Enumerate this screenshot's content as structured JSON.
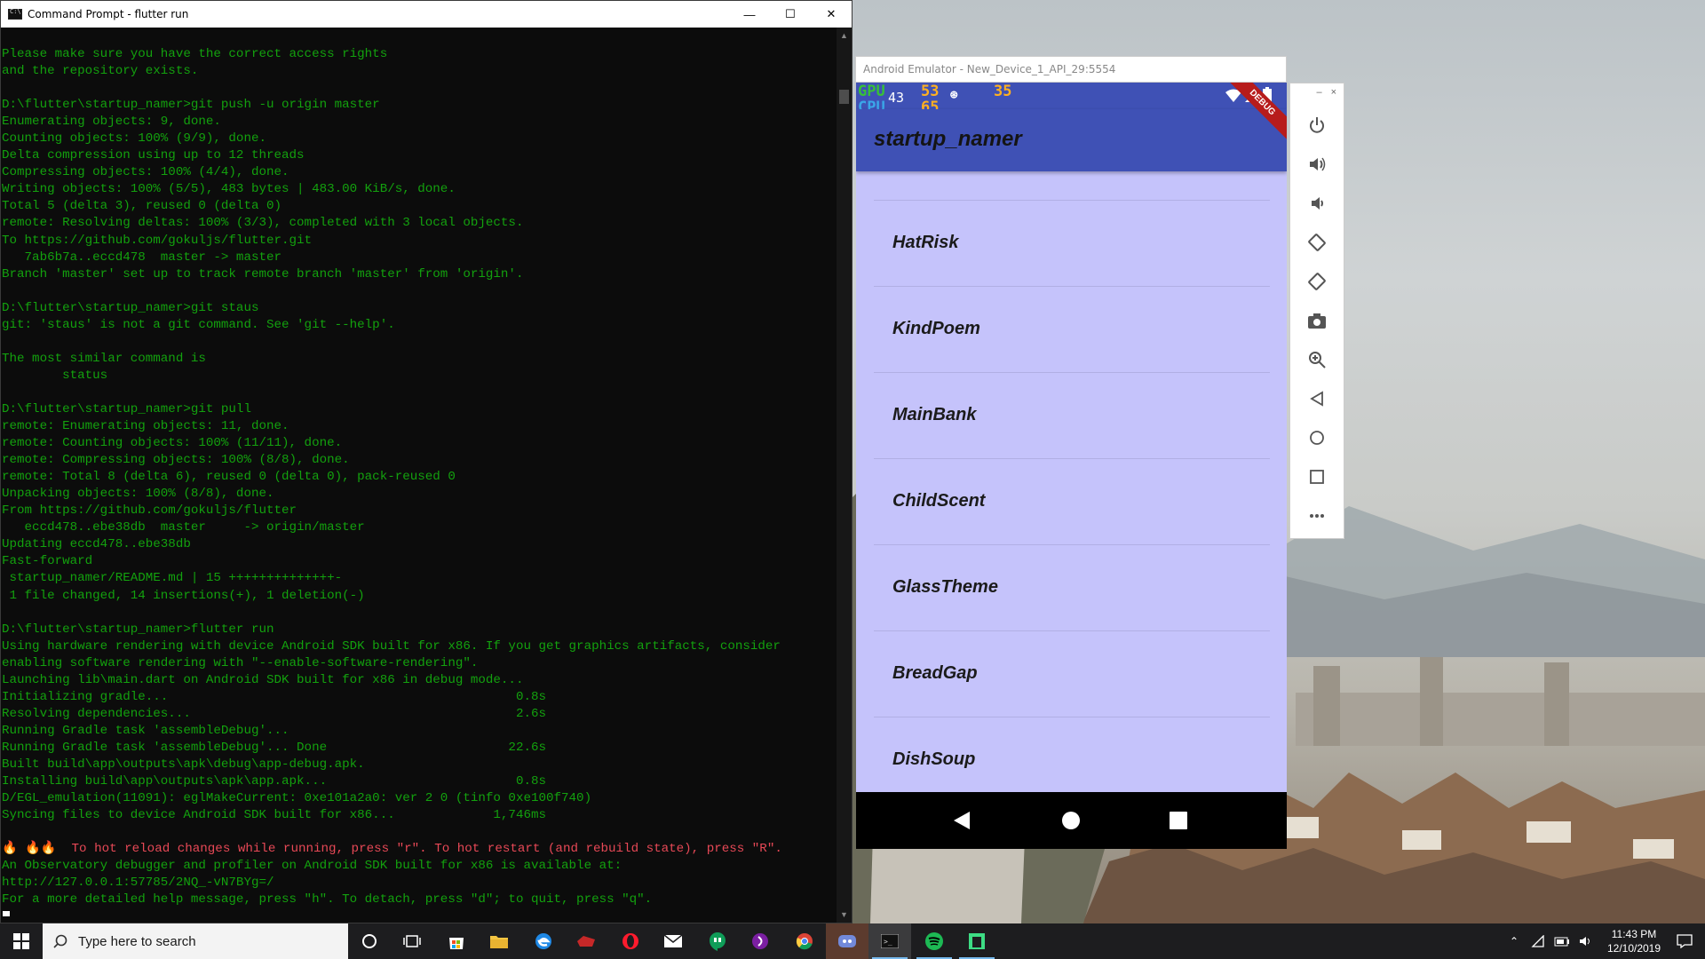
{
  "cmd": {
    "title": "Command Prompt - flutter  run",
    "window_buttons": {
      "minimize": "—",
      "maximize": "☐",
      "close": "✕"
    },
    "lines": [
      {
        "text": "Please make sure you have the correct access rights",
        "color": "green"
      },
      {
        "text": "and the repository exists.",
        "color": "green"
      },
      {
        "text": "",
        "color": "green"
      },
      {
        "text": "D:\\flutter\\startup_namer>git push -u origin master",
        "color": "green"
      },
      {
        "text": "Enumerating objects: 9, done.",
        "color": "green"
      },
      {
        "text": "Counting objects: 100% (9/9), done.",
        "color": "green"
      },
      {
        "text": "Delta compression using up to 12 threads",
        "color": "green"
      },
      {
        "text": "Compressing objects: 100% (4/4), done.",
        "color": "green"
      },
      {
        "text": "Writing objects: 100% (5/5), 483 bytes | 483.00 KiB/s, done.",
        "color": "green"
      },
      {
        "text": "Total 5 (delta 3), reused 0 (delta 0)",
        "color": "green"
      },
      {
        "text": "remote: Resolving deltas: 100% (3/3), completed with 3 local objects.",
        "color": "green"
      },
      {
        "text": "To https://github.com/gokuljs/flutter.git",
        "color": "green"
      },
      {
        "text": "   7ab6b7a..eccd478  master -> master",
        "color": "green"
      },
      {
        "text": "Branch 'master' set up to track remote branch 'master' from 'origin'.",
        "color": "green"
      },
      {
        "text": "",
        "color": "green"
      },
      {
        "text": "D:\\flutter\\startup_namer>git staus",
        "color": "green"
      },
      {
        "text": "git: 'staus' is not a git command. See 'git --help'.",
        "color": "green"
      },
      {
        "text": "",
        "color": "green"
      },
      {
        "text": "The most similar command is",
        "color": "green"
      },
      {
        "text": "        status",
        "color": "green"
      },
      {
        "text": "",
        "color": "green"
      },
      {
        "text": "D:\\flutter\\startup_namer>git pull",
        "color": "green"
      },
      {
        "text": "remote: Enumerating objects: 11, done.",
        "color": "green"
      },
      {
        "text": "remote: Counting objects: 100% (11/11), done.",
        "color": "green"
      },
      {
        "text": "remote: Compressing objects: 100% (8/8), done.",
        "color": "green"
      },
      {
        "text": "remote: Total 8 (delta 6), reused 0 (delta 0), pack-reused 0",
        "color": "green"
      },
      {
        "text": "Unpacking objects: 100% (8/8), done.",
        "color": "green"
      },
      {
        "text": "From https://github.com/gokuljs/flutter",
        "color": "green"
      },
      {
        "text": "   eccd478..ebe38db  master     -> origin/master",
        "color": "green"
      },
      {
        "text": "Updating eccd478..ebe38db",
        "color": "green"
      },
      {
        "text": "Fast-forward",
        "color": "green"
      },
      {
        "text": " startup_namer/README.md | 15 ++++++++++++++-",
        "color": "green"
      },
      {
        "text": " 1 file changed, 14 insertions(+), 1 deletion(-)",
        "color": "green"
      },
      {
        "text": "",
        "color": "green"
      },
      {
        "text": "D:\\flutter\\startup_namer>flutter run",
        "color": "green"
      },
      {
        "text": "Using hardware rendering with device Android SDK built for x86. If you get graphics artifacts, consider",
        "color": "green"
      },
      {
        "text": "enabling software rendering with \"--enable-software-rendering\".",
        "color": "green"
      },
      {
        "text": "Launching lib\\main.dart on Android SDK built for x86 in debug mode...",
        "color": "green"
      },
      {
        "text": "Initializing gradle...                                              0.8s",
        "color": "green"
      },
      {
        "text": "Resolving dependencies...                                           2.6s",
        "color": "green"
      },
      {
        "text": "Running Gradle task 'assembleDebug'...",
        "color": "green"
      },
      {
        "text": "Running Gradle task 'assembleDebug'... Done                        22.6s",
        "color": "green"
      },
      {
        "text": "Built build\\app\\outputs\\apk\\debug\\app-debug.apk.",
        "color": "green"
      },
      {
        "text": "Installing build\\app\\outputs\\apk\\app.apk...                         0.8s",
        "color": "green"
      },
      {
        "text": "D/EGL_emulation(11091): eglMakeCurrent: 0xe101a2a0: ver 2 0 (tinfo 0xe100f740)",
        "color": "green"
      },
      {
        "text": "Syncing files to device Android SDK built for x86...             1,746ms",
        "color": "green"
      },
      {
        "text": "",
        "color": "green"
      },
      {
        "text": "🔥 🔥🔥  To hot reload changes while running, press \"r\". To hot restart (and rebuild state), press \"R\".",
        "color": "red"
      },
      {
        "text": "An Observatory debugger and profiler on Android SDK built for x86 is available at:",
        "color": "green"
      },
      {
        "text": "http://127.0.0.1:57785/2NQ_-vN7BYg=/",
        "color": "green"
      },
      {
        "text": "For a more detailed help message, press \"h\". To detach, press \"d\"; to quit, press \"q\".",
        "color": "green"
      }
    ]
  },
  "emulator": {
    "window_title": "Android Emulator - New_Device_1_API_29:5554",
    "hud": {
      "gpu_label": "GPU",
      "cpu_label": "CPU",
      "gpu_value": "53",
      "cpu_value": "65",
      "temp_value": "35",
      "clock_fragment": "43"
    },
    "debug_banner": "DEBUG",
    "app_title": "startup_namer",
    "list_items": [
      "HatRisk",
      "KindPoem",
      "MainBank",
      "ChildScent",
      "GlassTheme",
      "BreadGap",
      "DishSoup"
    ],
    "side_panel": {
      "min_label": "–",
      "close_label": "×",
      "tools": [
        "power-icon",
        "volume-up-icon",
        "volume-down-icon",
        "rotate-left-icon",
        "rotate-right-icon",
        "camera-icon",
        "zoom-icon",
        "back-icon",
        "home-icon",
        "overview-icon",
        "more-icon"
      ]
    }
  },
  "taskbar": {
    "search_placeholder": "Type here to search",
    "apps": [
      "cortana",
      "task-view",
      "store",
      "file-explorer",
      "edge",
      "game-app",
      "opera",
      "mail",
      "hangouts",
      "podcast",
      "chrome",
      "discord",
      "command-prompt",
      "spotify",
      "android-studio"
    ],
    "time": "11:43 PM",
    "date": "12/10/2019"
  },
  "colors": {
    "terminal_green": "#13a10e",
    "terminal_red": "#e74856",
    "appbar": "#3f51b5",
    "list_bg": "#c5c3fb"
  }
}
